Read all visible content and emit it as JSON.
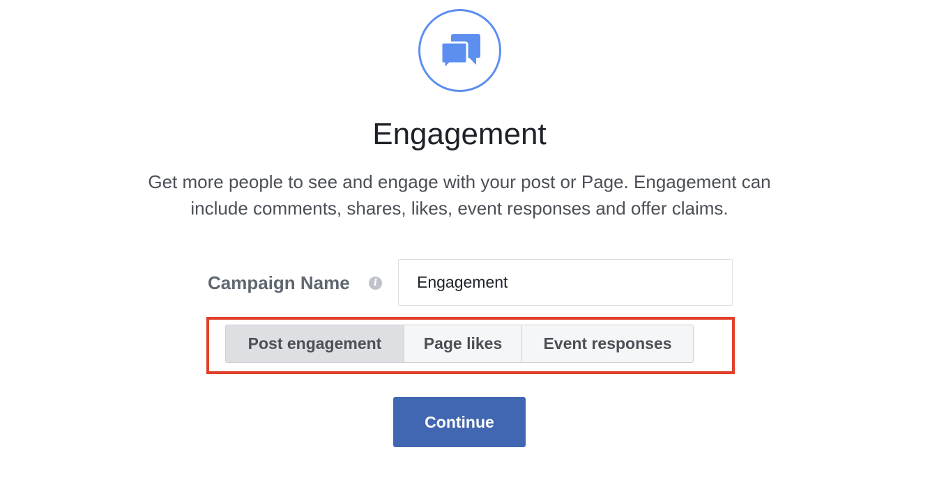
{
  "objective": {
    "icon": "chat-bubbles-icon",
    "accent_color": "#5d8ff0",
    "title": "Engagement",
    "description_lines": [
      "Get more people to see and engage with your post or Page. Engagement can",
      "include comments, shares, likes, event responses and offer claims."
    ]
  },
  "campaign_name": {
    "label": "Campaign Name",
    "info_icon": "info-icon",
    "info_glyph": "i",
    "value": "Engagement"
  },
  "engagement_types": {
    "options": [
      {
        "label": "Post engagement",
        "selected": true
      },
      {
        "label": "Page likes",
        "selected": false
      },
      {
        "label": "Event responses",
        "selected": false
      }
    ],
    "highlight_color": "#e0402a"
  },
  "continue_button": {
    "label": "Continue",
    "color": "#4267b2"
  }
}
